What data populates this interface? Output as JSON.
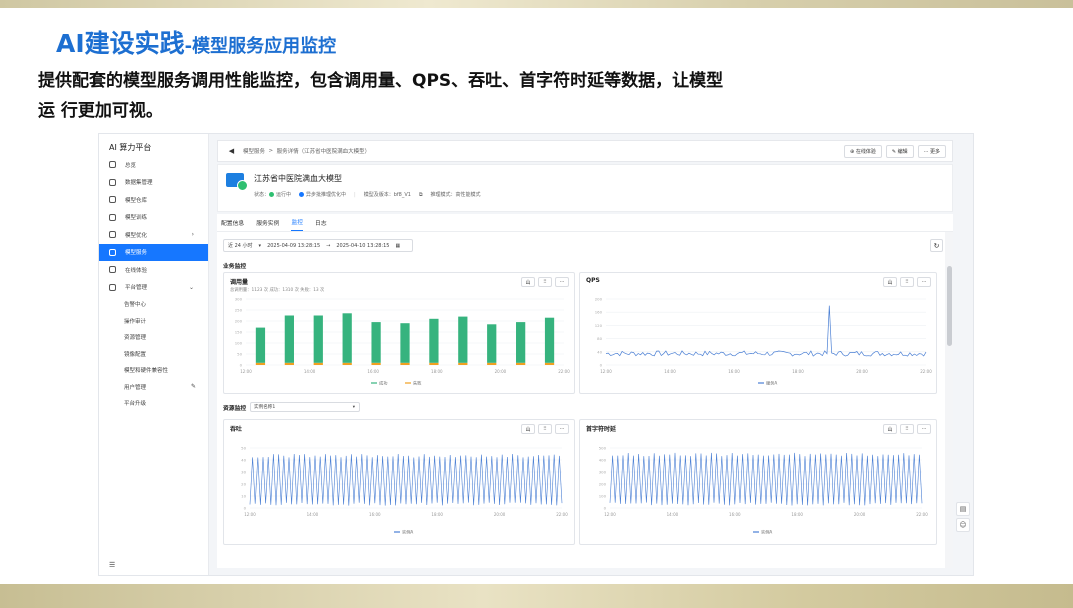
{
  "slide": {
    "title_main": "AI建设实践",
    "title_sub": "-模型服务应用监控",
    "description_line1": "提供配套的模型服务调用性能监控，包含调用量、QPS、吞吐、首字符时延等数据，让模型",
    "description_line2": "运 行更加可视。"
  },
  "app": {
    "brand": "AI 算力平台",
    "sidebar": {
      "items": [
        {
          "label": "总览",
          "icon": "overview-icon"
        },
        {
          "label": "数据集管理",
          "icon": "dataset-icon"
        },
        {
          "label": "模型仓库",
          "icon": "model-repo-icon"
        },
        {
          "label": "模型训练",
          "icon": "training-icon"
        },
        {
          "label": "模型优化",
          "icon": "optimize-icon",
          "expandable": true
        },
        {
          "label": "模型服务",
          "icon": "service-icon",
          "active": true
        },
        {
          "label": "在线体验",
          "icon": "experience-icon"
        },
        {
          "label": "平台管理",
          "icon": "platform-icon",
          "expanded": true
        }
      ],
      "sub_items": [
        "告警中心",
        "操作审计",
        "资源管理",
        "镜像配置",
        "模型和硬件兼容性",
        "用户管理",
        "平台升级"
      ],
      "footer_icon": "collapse-menu-icon"
    },
    "breadcrumb": {
      "items": [
        "模型服务",
        ">",
        "服务详情（江苏省中医院满血大模型）"
      ]
    },
    "top_actions": [
      "在线体验",
      "编辑",
      "··· 更多"
    ],
    "service": {
      "name": "江苏省中医院满血大模型",
      "status_label": "状态：",
      "status": "运行中",
      "status_color": "#2fbf71",
      "optimize": "异步批推理优化中",
      "optimize_color": "#1677ff",
      "model_version": "模型及版本：bf8_V1",
      "deploy_mode": "推理模式：高性能模式"
    },
    "tabs": [
      "配置信息",
      "服务实例",
      "监控",
      "日志"
    ],
    "active_tab": "监控",
    "filter": {
      "range": "近 24 小时",
      "start": "2025-04-09 13:28:15",
      "to": "→",
      "end": "2025-04-10 13:28:15"
    },
    "business_title": "业务监控",
    "resource_title": "资源监控",
    "instance_select": "实例名称1",
    "panel_buttons": [
      "山",
      "⁝⁝",
      "···"
    ],
    "panels": {
      "calls": {
        "title": "调用量",
        "subtitle": "总调用量：1123 次  成功：1310 次  失败：13 次"
      },
      "qps": {
        "title": "QPS"
      },
      "throughput": {
        "title": "吞吐"
      },
      "ttft": {
        "title": "首字符时延"
      }
    },
    "accent": "#1677ff"
  },
  "chart_data": [
    {
      "type": "bar",
      "title": "调用量",
      "categories": [
        "12:00",
        "13:00",
        "14:00",
        "15:00",
        "16:00",
        "17:00",
        "18:00",
        "19:00",
        "20:00",
        "21:00",
        "22:00"
      ],
      "x_ticks": [
        "12:00",
        "14:00",
        "16:00",
        "18:00",
        "20:00",
        "22:00"
      ],
      "y_ticks": [
        0,
        50,
        100,
        150,
        200,
        250,
        300
      ],
      "ylim": [
        0,
        300
      ],
      "stacked": true,
      "series": [
        {
          "name": "成功",
          "color": "#36b37e",
          "values": [
            160,
            215,
            215,
            225,
            185,
            180,
            200,
            210,
            175,
            185,
            205
          ]
        },
        {
          "name": "失败",
          "color": "#f0a020",
          "values": [
            10,
            10,
            10,
            10,
            10,
            10,
            10,
            10,
            10,
            10,
            10
          ]
        }
      ]
    },
    {
      "type": "line",
      "title": "QPS",
      "x_ticks": [
        "12:00",
        "14:00",
        "16:00",
        "18:00",
        "20:00",
        "22:00"
      ],
      "y_ticks": [
        0,
        40,
        80,
        120,
        160,
        200
      ],
      "ylim": [
        0,
        200
      ],
      "series": [
        {
          "name": "服务A",
          "color": "#4a7fd4",
          "baseline": 35,
          "noise": 8,
          "spike_at": 0.7,
          "spike_value": 180
        }
      ]
    },
    {
      "type": "line",
      "title": "吞吐",
      "x_ticks": [
        "12:00",
        "14:00",
        "16:00",
        "18:00",
        "20:00",
        "22:00"
      ],
      "y_ticks": [
        0,
        10,
        20,
        30,
        40,
        50
      ],
      "ylim": [
        0,
        50
      ],
      "series": [
        {
          "name": "实例A",
          "color": "#4a7fd4",
          "low": 2,
          "high": 45,
          "cycles": 60
        }
      ]
    },
    {
      "type": "line",
      "title": "首字符时延",
      "x_ticks": [
        "12:00",
        "14:00",
        "16:00",
        "18:00",
        "20:00",
        "22:00"
      ],
      "y_ticks": [
        0,
        100,
        200,
        300,
        400,
        500
      ],
      "ylim": [
        0,
        500
      ],
      "series": [
        {
          "name": "实例A",
          "color": "#4a7fd4",
          "low": 20,
          "high": 460,
          "cycles": 60
        }
      ]
    }
  ]
}
